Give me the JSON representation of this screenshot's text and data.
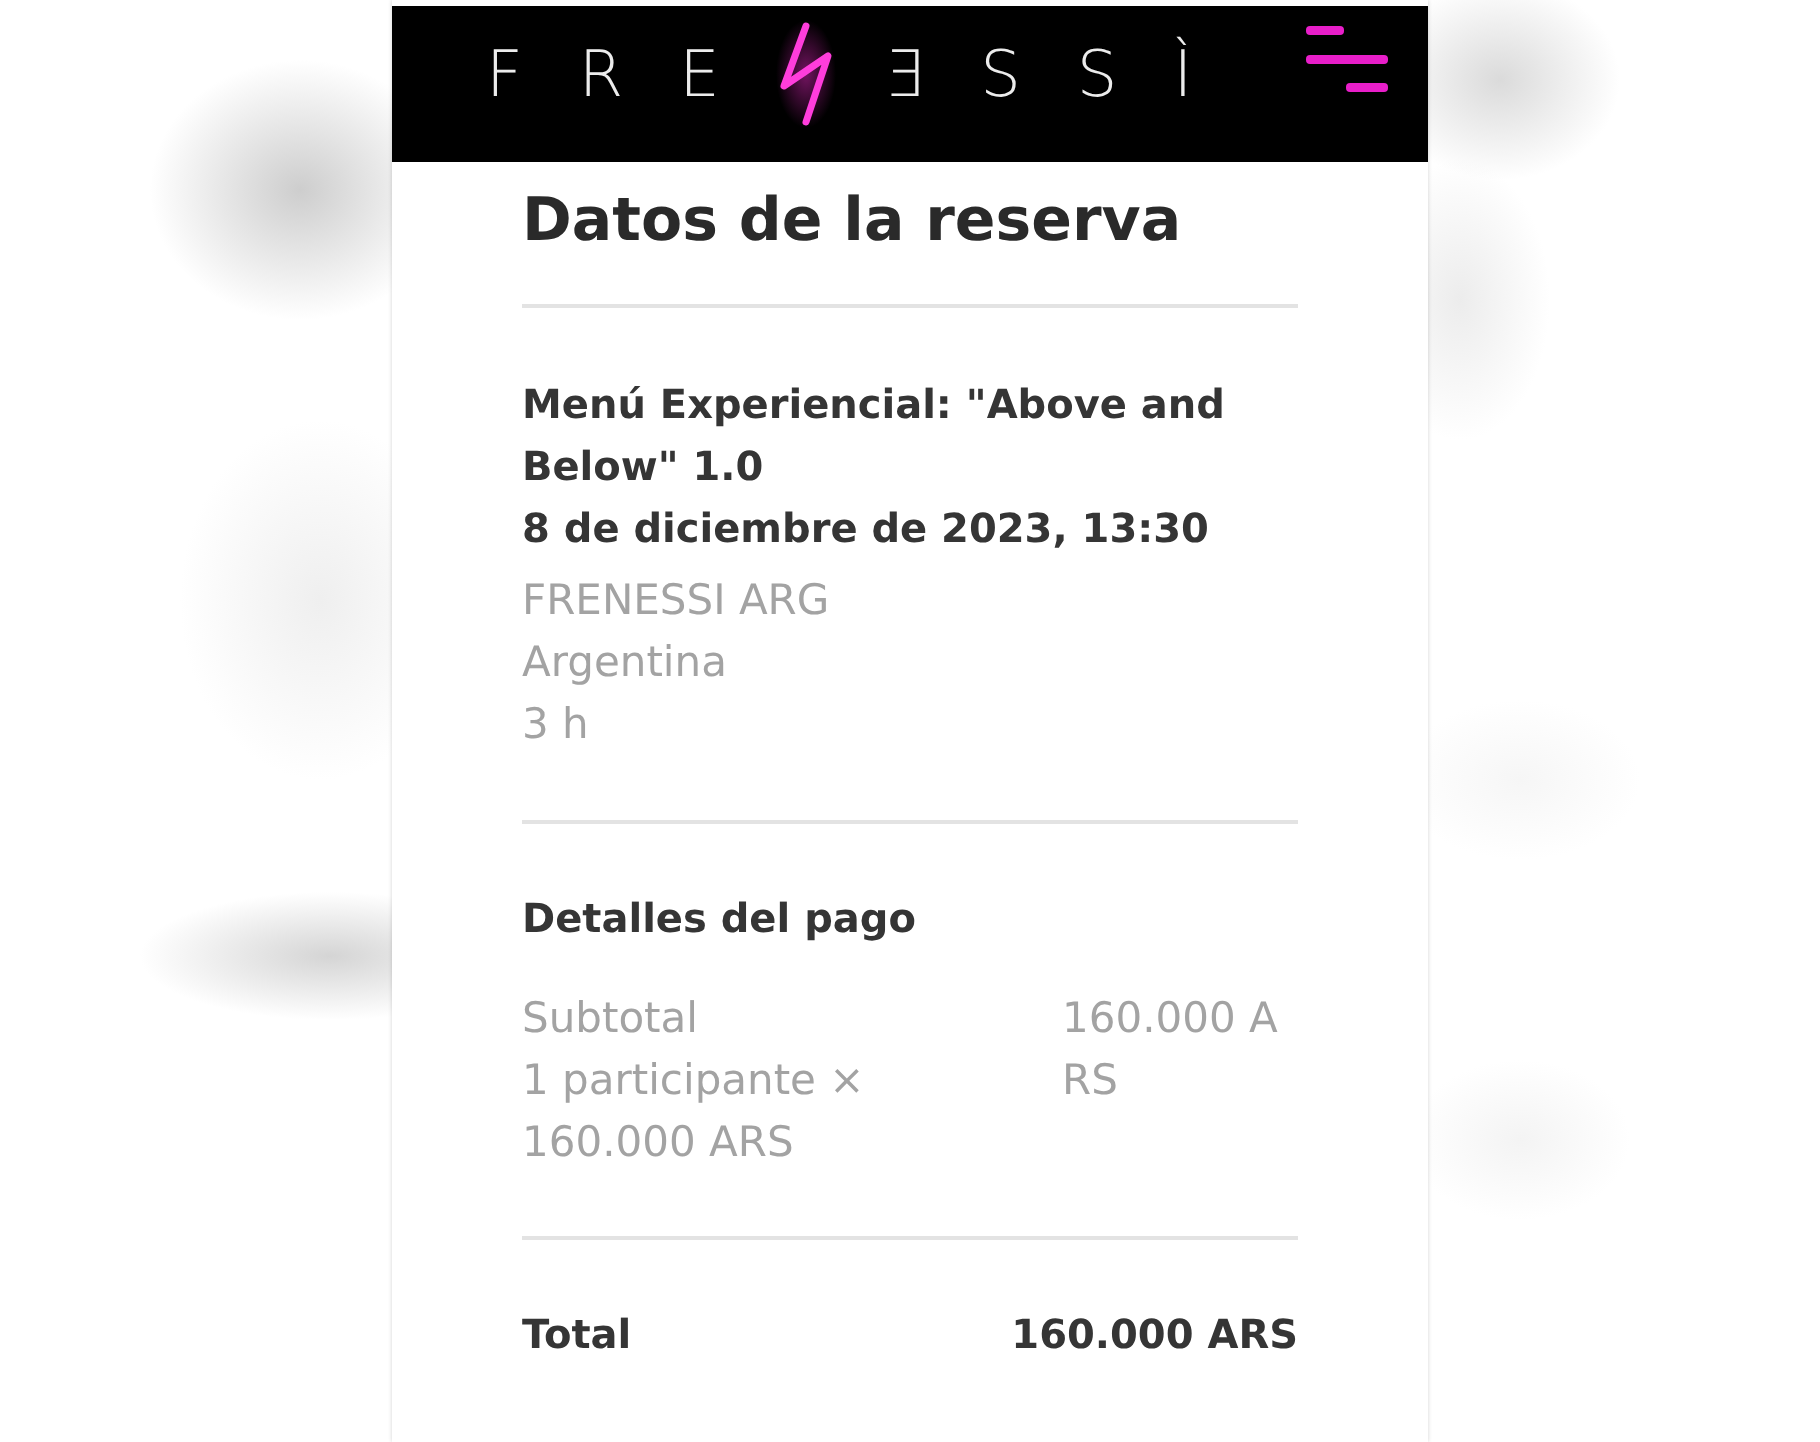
{
  "header": {
    "logo_left": "FRE",
    "logo_right": "ƎSSÌ"
  },
  "reservation": {
    "title": "Datos de la reserva",
    "experience": "Menú Experiencial: \"Above and Below\" 1.0",
    "date": "8 de diciembre de 2023, 13:30",
    "details": [
      "FRENESSI ARG",
      "Argentina",
      "3 h"
    ]
  },
  "payment": {
    "heading": "Detalles del pago",
    "lines": [
      {
        "label": "Subtotal",
        "detail": "1 participante × 160.000 ARS",
        "amount": "160.000 ARS"
      }
    ],
    "total": {
      "label": "Total",
      "amount": "160.000 ARS"
    }
  }
}
